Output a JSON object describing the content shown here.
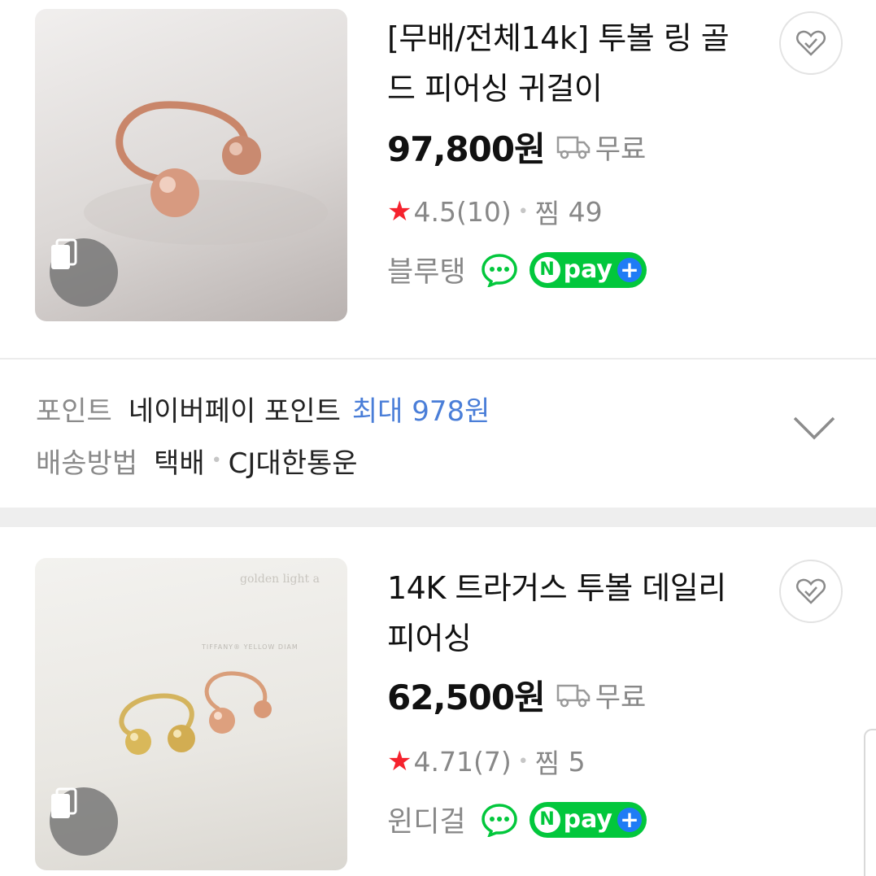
{
  "products": [
    {
      "title": "[무배/전체14k] 투볼 링 골드 피어싱 귀걸이",
      "price": "97,800원",
      "shipping": "무료",
      "rating": "4.5",
      "review_count": "(10)",
      "wish_label": "찜",
      "wish_count": "49",
      "seller": "블루탱",
      "npay": "pay"
    },
    {
      "title": "14K 트라거스 투볼 데일리 피어싱",
      "price": "62,500원",
      "shipping": "무료",
      "rating": "4.71",
      "review_count": "(7)",
      "wish_label": "찜",
      "wish_count": "5",
      "seller": "윈디걸",
      "npay": "pay",
      "image_text_1": "golden light a",
      "image_text_2": "TIFFANY® YELLOW DIAM"
    }
  ],
  "info": {
    "point_label": "포인트",
    "point_value": "네이버페이 포인트",
    "point_max": "최대 978원",
    "delivery_label": "배송방법",
    "delivery_value": "택배",
    "delivery_carrier": "CJ대한통운"
  },
  "colors": {
    "star": "#f5222d",
    "npay_green": "#02c73c",
    "npay_plus_blue": "#1f7cf5",
    "point_highlight": "#4a7ed8"
  },
  "icons": [
    "star-icon",
    "truck-icon",
    "talk-icon",
    "wish-icon",
    "gallery-icon",
    "chevron-down-icon"
  ]
}
